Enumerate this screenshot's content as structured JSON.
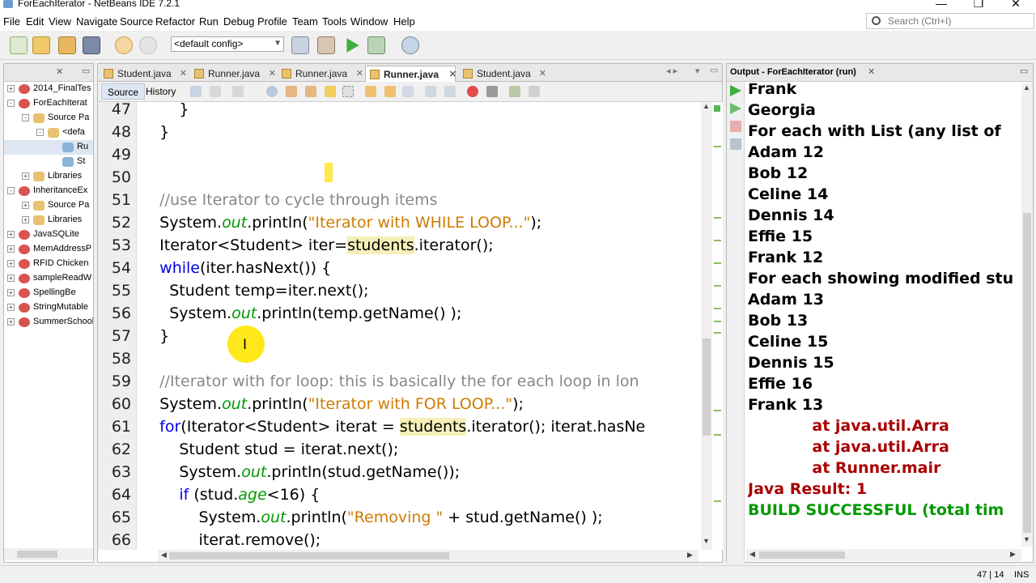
{
  "window": {
    "title": "ForEachIterator - NetBeans IDE 7.2.1"
  },
  "menu": [
    "File",
    "Edit",
    "View",
    "Navigate",
    "Source",
    "Refactor",
    "Run",
    "Debug",
    "Profile",
    "Team",
    "Tools",
    "Window",
    "Help"
  ],
  "search": {
    "placeholder": "Search (Ctrl+I)"
  },
  "toolbar": {
    "config": "<default config>"
  },
  "project_tree": [
    {
      "label": "2014_FinalTes",
      "indent": 0,
      "type": "project",
      "toggle": "+"
    },
    {
      "label": "ForEachIterat",
      "indent": 0,
      "type": "project",
      "toggle": "-"
    },
    {
      "label": "Source Pa",
      "indent": 1,
      "type": "folder",
      "toggle": "-"
    },
    {
      "label": "<defa",
      "indent": 2,
      "type": "package",
      "toggle": "-"
    },
    {
      "label": "Ru",
      "indent": 3,
      "type": "java",
      "toggle": ""
    },
    {
      "label": "St",
      "indent": 3,
      "type": "java",
      "toggle": ""
    },
    {
      "label": "Libraries",
      "indent": 1,
      "type": "folder",
      "toggle": "+"
    },
    {
      "label": "InheritanceEx",
      "indent": 0,
      "type": "project",
      "toggle": "-"
    },
    {
      "label": "Source Pa",
      "indent": 1,
      "type": "folder",
      "toggle": "+"
    },
    {
      "label": "Libraries",
      "indent": 1,
      "type": "folder",
      "toggle": "+"
    },
    {
      "label": "JavaSQLite",
      "indent": 0,
      "type": "project",
      "toggle": "+"
    },
    {
      "label": "MemAddressP",
      "indent": 0,
      "type": "project",
      "toggle": "+"
    },
    {
      "label": "RFID Chicken",
      "indent": 0,
      "type": "project",
      "toggle": "+"
    },
    {
      "label": "sampleReadW",
      "indent": 0,
      "type": "project",
      "toggle": "+"
    },
    {
      "label": "SpellingBe",
      "indent": 0,
      "type": "project",
      "toggle": "+"
    },
    {
      "label": "StringMutable",
      "indent": 0,
      "type": "project",
      "toggle": "+"
    },
    {
      "label": "SummerSchool",
      "indent": 0,
      "type": "project",
      "toggle": "+"
    }
  ],
  "editor_tabs": [
    {
      "label": "Student.java",
      "active": false
    },
    {
      "label": "Runner.java",
      "active": false
    },
    {
      "label": "Runner.java",
      "active": false
    },
    {
      "label": "Runner.java",
      "active": true
    },
    {
      "label": "Student.java",
      "active": false
    }
  ],
  "subtabs": {
    "source": "Source",
    "history": "History"
  },
  "code_lines": [
    {
      "n": "47",
      "parts": [
        {
          "t": "        }",
          "c": ""
        }
      ]
    },
    {
      "n": "48",
      "parts": [
        {
          "t": "    }",
          "c": ""
        }
      ]
    },
    {
      "n": "49",
      "parts": []
    },
    {
      "n": "50",
      "parts": []
    },
    {
      "n": "51",
      "parts": [
        {
          "t": "    //use Iterator to cycle through items",
          "c": "cm"
        }
      ]
    },
    {
      "n": "52",
      "parts": [
        {
          "t": "    System.",
          "c": ""
        },
        {
          "t": "out",
          "c": "fld"
        },
        {
          "t": ".println(",
          "c": ""
        },
        {
          "t": "\"Iterator with WHILE LOOP...\"",
          "c": "str"
        },
        {
          "t": ");",
          "c": ""
        }
      ]
    },
    {
      "n": "53",
      "parts": [
        {
          "t": "    Iterator<Student> iter=",
          "c": ""
        },
        {
          "t": "students",
          "c": "hl"
        },
        {
          "t": ".iterator();",
          "c": ""
        }
      ]
    },
    {
      "n": "54",
      "parts": [
        {
          "t": "    ",
          "c": ""
        },
        {
          "t": "while",
          "c": "kw"
        },
        {
          "t": "(iter.hasNext()) {",
          "c": ""
        }
      ]
    },
    {
      "n": "55",
      "parts": [
        {
          "t": "      Student temp=iter.next();",
          "c": ""
        }
      ]
    },
    {
      "n": "56",
      "parts": [
        {
          "t": "      System.",
          "c": ""
        },
        {
          "t": "out",
          "c": "fld"
        },
        {
          "t": ".println(temp.getName() );",
          "c": ""
        }
      ]
    },
    {
      "n": "57",
      "parts": [
        {
          "t": "    }",
          "c": ""
        }
      ]
    },
    {
      "n": "58",
      "parts": []
    },
    {
      "n": "59",
      "parts": [
        {
          "t": "    //Iterator with for loop: this is basically the for each loop in lon",
          "c": "cm"
        }
      ]
    },
    {
      "n": "60",
      "parts": [
        {
          "t": "    System.",
          "c": ""
        },
        {
          "t": "out",
          "c": "fld"
        },
        {
          "t": ".println(",
          "c": ""
        },
        {
          "t": "\"Iterator with FOR LOOP...\"",
          "c": "str"
        },
        {
          "t": ");",
          "c": ""
        }
      ]
    },
    {
      "n": "61",
      "parts": [
        {
          "t": "    ",
          "c": ""
        },
        {
          "t": "for",
          "c": "kw"
        },
        {
          "t": "(Iterator<Student> iterat = ",
          "c": ""
        },
        {
          "t": "students",
          "c": "hl"
        },
        {
          "t": ".iterator(); iterat.hasNe",
          "c": ""
        }
      ]
    },
    {
      "n": "62",
      "parts": [
        {
          "t": "        Student stud = iterat.next();",
          "c": ""
        }
      ]
    },
    {
      "n": "63",
      "parts": [
        {
          "t": "        System.",
          "c": ""
        },
        {
          "t": "out",
          "c": "fld"
        },
        {
          "t": ".println(stud.getName());",
          "c": ""
        }
      ]
    },
    {
      "n": "64",
      "parts": [
        {
          "t": "        ",
          "c": ""
        },
        {
          "t": "if",
          "c": "kw"
        },
        {
          "t": " (stud.",
          "c": ""
        },
        {
          "t": "age",
          "c": "fld"
        },
        {
          "t": "<16) {",
          "c": ""
        }
      ]
    },
    {
      "n": "65",
      "parts": [
        {
          "t": "            System.",
          "c": ""
        },
        {
          "t": "out",
          "c": "fld"
        },
        {
          "t": ".println(",
          "c": ""
        },
        {
          "t": "\"Removing \"",
          "c": "str"
        },
        {
          "t": " + stud.getName() );",
          "c": ""
        }
      ]
    },
    {
      "n": "66",
      "parts": [
        {
          "t": "            iterat.remove();",
          "c": ""
        }
      ]
    }
  ],
  "output": {
    "title": "Output - ForEachIterator (run)",
    "lines": [
      {
        "t": "Frank",
        "c": ""
      },
      {
        "t": "Georgia",
        "c": ""
      },
      {
        "t": "For each with List (any list of",
        "c": ""
      },
      {
        "t": "Adam 12",
        "c": ""
      },
      {
        "t": "Bob 12",
        "c": ""
      },
      {
        "t": "Celine 14",
        "c": ""
      },
      {
        "t": "Dennis 14",
        "c": ""
      },
      {
        "t": "Effie 15",
        "c": ""
      },
      {
        "t": "Frank 12",
        "c": ""
      },
      {
        "t": "For each showing modified stu",
        "c": ""
      },
      {
        "t": "Adam 13",
        "c": ""
      },
      {
        "t": "Bob 13",
        "c": ""
      },
      {
        "t": "Celine 15",
        "c": ""
      },
      {
        "t": "Dennis 15",
        "c": ""
      },
      {
        "t": "Effie 16",
        "c": ""
      },
      {
        "t": "Frank 13",
        "c": ""
      },
      {
        "t": "            at java.util.Arra",
        "c": "err"
      },
      {
        "t": "            at java.util.Arra",
        "c": "err"
      },
      {
        "t": "            at Runner.mair",
        "c": "err"
      },
      {
        "t": "Java Result: 1",
        "c": "err"
      },
      {
        "t": "BUILD SUCCESSFUL (total tim",
        "c": "ok"
      }
    ]
  },
  "status": {
    "position": "47 | 14",
    "mode": "INS"
  }
}
